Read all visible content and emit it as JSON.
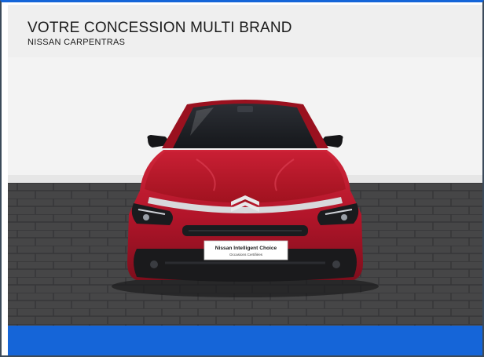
{
  "header": {
    "title": "VOTRE CONCESSION MULTI BRAND",
    "subtitle": "NISSAN CARPENTRAS"
  },
  "photo": {
    "plate_line1": "Nissan Intelligent Choice",
    "plate_line2": "Occasions Certifiées"
  },
  "colors": {
    "accent": "#1565d8",
    "header_bg": "#efefef",
    "car_body": "#b3152a"
  }
}
